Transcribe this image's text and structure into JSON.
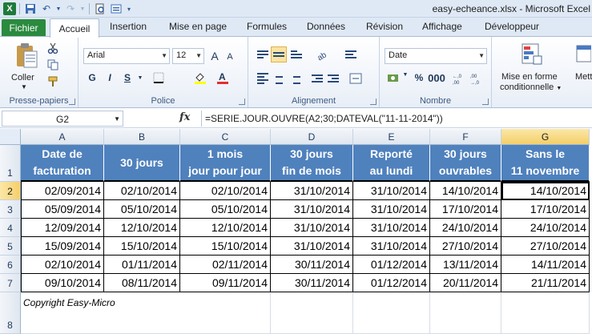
{
  "window": {
    "title": "easy-echeance.xlsx  -  Microsoft Excel",
    "app_logo": "X"
  },
  "tabs": {
    "file": "Fichier",
    "items": [
      "Accueil",
      "Insertion",
      "Mise en page",
      "Formules",
      "Données",
      "Révision",
      "Affichage",
      "Développeur"
    ]
  },
  "ribbon": {
    "clipboard": {
      "label": "Presse-papiers",
      "paste": "Coller"
    },
    "font": {
      "label": "Police",
      "name": "Arial",
      "size": "12",
      "bold": "G",
      "italic": "I",
      "underline": "S",
      "grow": "A",
      "shrink": "A"
    },
    "alignment": {
      "label": "Alignement"
    },
    "number": {
      "label": "Nombre",
      "format": "Date"
    },
    "styles": {
      "conditional_line1": "Mise en forme",
      "conditional_line2": "conditionnelle",
      "next_line1": "Mett"
    }
  },
  "formula_bar": {
    "name_box": "G2",
    "fx": "fx",
    "formula": "=SERIE.JOUR.OUVRE(A2;30;DATEVAL(\"11-11-2014\"))"
  },
  "columns": [
    "A",
    "B",
    "C",
    "D",
    "E",
    "F",
    "G"
  ],
  "rows": [
    "1",
    "2",
    "3",
    "4",
    "5",
    "6",
    "7",
    "8"
  ],
  "headers": [
    [
      "Date de",
      "facturation"
    ],
    [
      "30 jours",
      ""
    ],
    [
      "1 mois",
      "jour pour jour"
    ],
    [
      "30 jours",
      "fin de mois"
    ],
    [
      "Reporté",
      "au lundi"
    ],
    [
      "30 jours",
      "ouvrables"
    ],
    [
      "Sans le",
      "11 novembre"
    ]
  ],
  "data": [
    [
      "02/09/2014",
      "02/10/2014",
      "02/10/2014",
      "31/10/2014",
      "31/10/2014",
      "14/10/2014",
      "14/10/2014"
    ],
    [
      "05/09/2014",
      "05/10/2014",
      "05/10/2014",
      "31/10/2014",
      "31/10/2014",
      "17/10/2014",
      "17/10/2014"
    ],
    [
      "12/09/2014",
      "12/10/2014",
      "12/10/2014",
      "31/10/2014",
      "31/10/2014",
      "24/10/2014",
      "24/10/2014"
    ],
    [
      "15/09/2014",
      "15/10/2014",
      "15/10/2014",
      "31/10/2014",
      "31/10/2014",
      "27/10/2014",
      "27/10/2014"
    ],
    [
      "02/10/2014",
      "01/11/2014",
      "02/11/2014",
      "30/11/2014",
      "01/12/2014",
      "13/11/2014",
      "14/11/2014"
    ],
    [
      "09/10/2014",
      "08/11/2014",
      "09/11/2014",
      "30/11/2014",
      "01/12/2014",
      "20/11/2014",
      "21/11/2014"
    ]
  ],
  "footer": "Copyright Easy-Micro",
  "colors": {
    "header_fill": "#4f81bd",
    "file_tab": "#2a8a3e",
    "selection": "#f4cf6a"
  }
}
